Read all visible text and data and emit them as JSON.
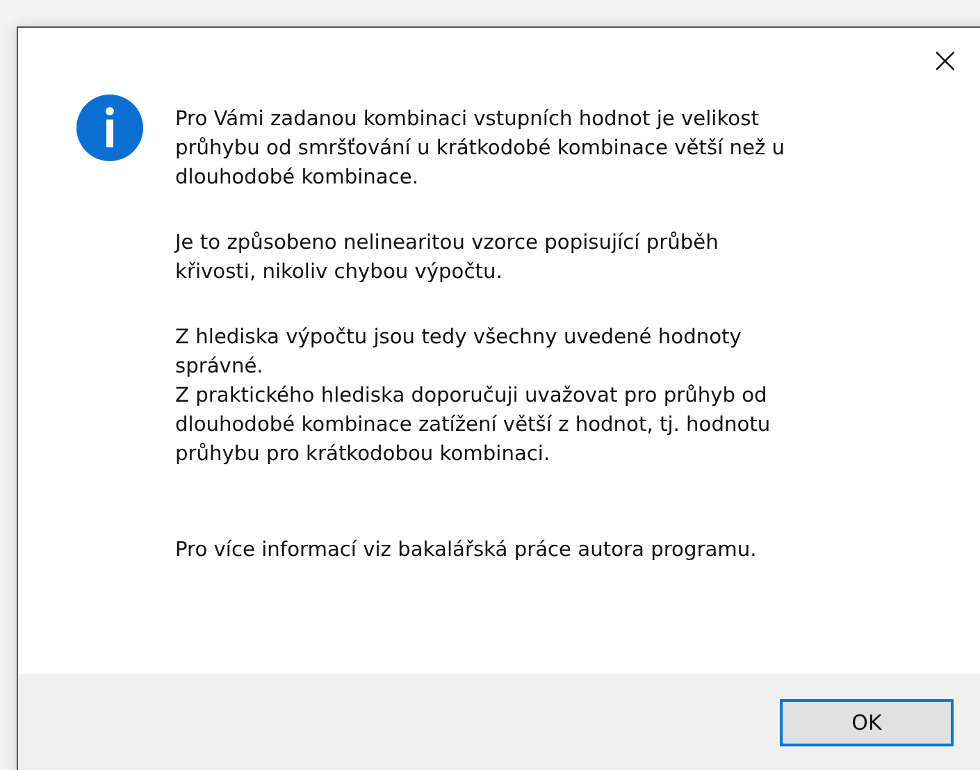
{
  "dialog": {
    "close_button": "×",
    "paragraphs": [
      [
        "Pro Vámi zadanou kombinaci vstupních hodnot je velikost",
        "průhybu od smršťování u krátkodobé kombinace větší než u",
        "dlouhodobé kombinace."
      ],
      [
        "Je to způsobeno nelinearitou vzorce popisující průběh",
        "křivosti, nikoliv chybou výpočtu."
      ],
      [
        "Z hlediska výpočtu jsou tedy všechny uvedené hodnoty",
        "správné.",
        "Z praktického hlediska doporučuji uvažovat pro průhyb od",
        "dlouhodobé kombinace zatížení větší z hodnot, tj. hodnotu",
        "průhybu pro krátkodobou kombinaci."
      ],
      [
        "Pro více informací viz bakalářská práce autora programu."
      ]
    ],
    "buttons": [
      {
        "label": "OK",
        "default": true
      }
    ]
  }
}
